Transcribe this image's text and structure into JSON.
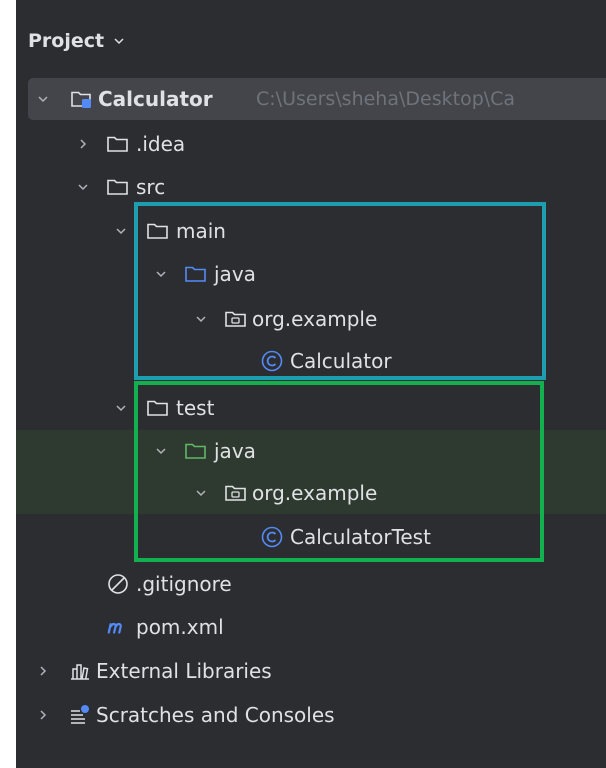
{
  "header": {
    "title": "Project"
  },
  "tree": {
    "root": {
      "label": "Calculator",
      "path": "C:\\Users\\sheha\\Desktop\\Ca"
    },
    "idea": {
      "label": ".idea"
    },
    "src": {
      "label": "src"
    },
    "main": {
      "label": "main"
    },
    "main_java": {
      "label": "java"
    },
    "main_pkg": {
      "label": "org.example"
    },
    "main_class": {
      "label": "Calculator"
    },
    "test": {
      "label": "test"
    },
    "test_java": {
      "label": "java"
    },
    "test_pkg": {
      "label": "org.example"
    },
    "test_class": {
      "label": "CalculatorTest"
    },
    "gitignore": {
      "label": ".gitignore"
    },
    "pom": {
      "label": "pom.xml"
    },
    "external": {
      "label": "External Libraries"
    },
    "scratches": {
      "label": "Scratches and Consoles"
    }
  },
  "colors": {
    "panel_bg": "#2b2d30",
    "text": "#dfe1e5",
    "blue_box": "#1f9db0",
    "green_box": "#12b04f",
    "source_folder": "#548af7",
    "test_folder": "#5fb865",
    "class_icon": "#548af7",
    "maven_icon": "#548af7"
  }
}
